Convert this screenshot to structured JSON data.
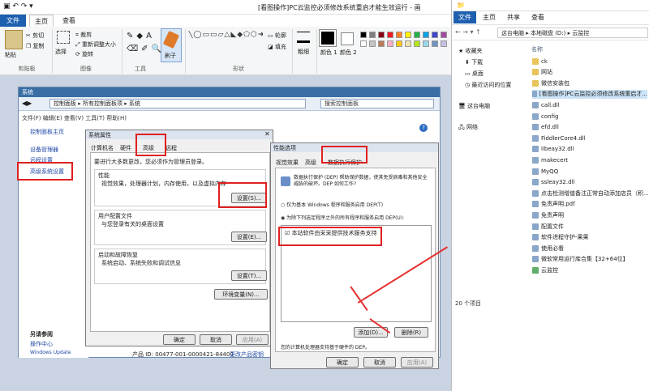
{
  "paint": {
    "title": "[看图操作]PC云监控必须修改系统重启才能生效运行 - 画",
    "tabs": [
      "文件",
      "主页",
      "查看"
    ],
    "clip": {
      "paste": "粘贴",
      "cut": "剪切",
      "copy": "复制",
      "label": "剪贴板"
    },
    "image": {
      "select": "选择",
      "crop": "裁剪",
      "resize": "重新调整大小",
      "rotate": "旋转",
      "label": "图像"
    },
    "tools": {
      "label": "工具"
    },
    "brush": "刷子",
    "shapes": {
      "outline": "轮廓",
      "fill": "填充",
      "label": "形状"
    },
    "size": "粗细",
    "colors": {
      "c1": "颜色 1",
      "c2": "颜色 2"
    },
    "palette": [
      "#000000",
      "#7f7f7f",
      "#880015",
      "#ed1c24",
      "#ff7f27",
      "#fff200",
      "#22b14c",
      "#00a2e8",
      "#3f48cc",
      "#a349a4",
      "#ffffff",
      "#c3c3c3",
      "#b97a57",
      "#ffaec9",
      "#ffc90e",
      "#efe4b0",
      "#b5e61d",
      "#99d9ea",
      "#7092be",
      "#c8bfe7"
    ]
  },
  "system": {
    "title": "系统",
    "breadcrumb": "控制面板 ▸ 所有控制面板项 ▸ 系统",
    "search_placeholder": "搜索控制面板",
    "menu": "文件(F)  编辑(E)  查看(V)  工具(T)  帮助(H)",
    "home": "控制面板主页",
    "links": [
      "设备管理器",
      "远程设置",
      "高级系统设置"
    ],
    "see_also": "另请参阅",
    "action_center": "操作中心",
    "windows_update": "Windows Update",
    "product_id": "产品 ID: 00477-001-0000421-84400",
    "change_key": "更改产品密钥"
  },
  "sysprops": {
    "title": "系统属性",
    "tabs": [
      "计算机名",
      "硬件",
      "高级",
      "远程"
    ],
    "admin_note": "要进行大多数更改，您必须作为管理员登录。",
    "perf_title": "性能",
    "perf_desc": "视觉效果，处理器计划，内存使用，以及虚拟内存",
    "settings1": "设置(S)...",
    "profile_title": "用户配置文件",
    "profile_desc": "与您登录有关的桌面设置",
    "settings2": "设置(E)...",
    "startup_title": "启动和故障恢复",
    "startup_desc": "系统启动、系统失败和调试信息",
    "settings3": "设置(T)...",
    "env": "环境变量(N)...",
    "ok": "确定",
    "cancel": "取消",
    "apply": "应用(A)"
  },
  "perfopts": {
    "title": "性能选项",
    "tabs": [
      "视觉效果",
      "高级",
      "数据执行保护"
    ],
    "desc": "数据执行保护 (DEP) 帮助保护数据，使其免受病毒和其他安全威胁的破坏。DEP 如何工作?",
    "opt1": "仅为基本 Windows 程序和服务启用 DEP(T)",
    "opt2": "为除下列选定程序之外的所有程序和服务启用 DEP(U):",
    "item": "本站软件由采采提供技术服务支持",
    "add": "添加(D)...",
    "remove": "删除(R)",
    "hw": "您的计算机处理器支持基于硬件的 DEP。",
    "ok": "确定",
    "cancel": "取消",
    "apply": "应用(A)"
  },
  "explorer": {
    "tabs": [
      "文件",
      "主页",
      "共享",
      "查看"
    ],
    "path": "这台电脑 ▸ 本地磁盘 (D:) ▸ 云监控",
    "nav": [
      "收藏夹",
      "下载",
      "桌面",
      "最近访问的位置",
      "这台电脑",
      "网络"
    ],
    "col": "名称",
    "files": [
      "ck",
      "网站",
      "微信安装包",
      "[看图操作]PC云监控必须修改系统重启才...",
      "call.dll",
      "config",
      "efd.dll",
      "FiddlerCore4.dll",
      "libeay32.dll",
      "makecert",
      "MyQQ",
      "ssleay32.dll",
      "点击检测增值备注正常自动添加店员（积...",
      "免责声明.pdf",
      "免责声明",
      "配置文件",
      "软件进程守护-果果",
      "使用必看",
      "微软常用运行库合集【32+64位】",
      "云监控"
    ],
    "count": "20 个项目"
  }
}
